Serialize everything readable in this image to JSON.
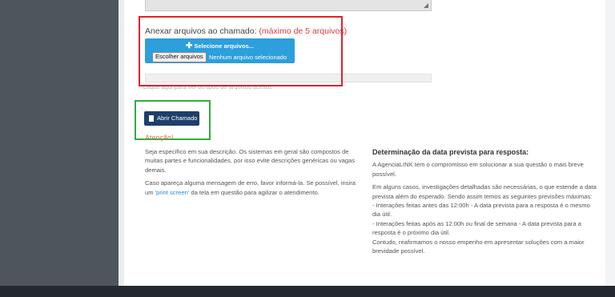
{
  "attach": {
    "label": "Anexar arquivos ao chamado:",
    "max_note": "(máximo de 5 arquivos)",
    "select_button": "Selecione arquivos...",
    "choose_button": "Escolher arquivos",
    "no_file_text": "Nenhum arquivo selecionado",
    "types_link": "Clique aqui para ver os tipos de arquivos aceitos"
  },
  "submit": {
    "label": "Abrir Chamado"
  },
  "attention": {
    "title": "Atenção!",
    "p1": "Seja específico em sua descrição. Os sistemas em geral são compostos de muitas partes e funcionalidades, por isso evite descrições genéricas ou vagas demais.",
    "p2_before": "Caso apareça alguma mensagem de erro, favor informá-la. Se possível, insira um ",
    "p2_link": "'print screen'",
    "p2_after": " da tela em questão para agilizar o atendimento."
  },
  "deadline": {
    "title": "Determinação da data prevista para resposta:",
    "p1": "A AgenciaLINK tem o compromisso em solucionar a sua questão o mais breve possível.",
    "p2": "Em alguns casos, investigações detalhadas são necessárias, o que estende a data prevista além do esperado. Sendo assim temos as seguintes previsões máximas:",
    "b1": "- Interações feitas antes das 12:00h - A data prevista para a resposta é o mesmo dia útil.",
    "b2": "- Interações feitas após as 12:00h ou final de semana - A data prevista para a resposta é o próximo dia útil.",
    "b3": "Contudo, reafirmamos o nosso empenho em apresentar soluções com a maior brevidade possível."
  },
  "colors": {
    "primary_button": "#1f3f6b",
    "upload_button": "#2c9fdc",
    "highlight_red": "#e0232e",
    "highlight_green": "#2fae3b",
    "sidebar": "#4e555b"
  },
  "icons": {
    "plus": "plus-icon",
    "document": "document-icon",
    "resize": "resize-handle-icon"
  }
}
